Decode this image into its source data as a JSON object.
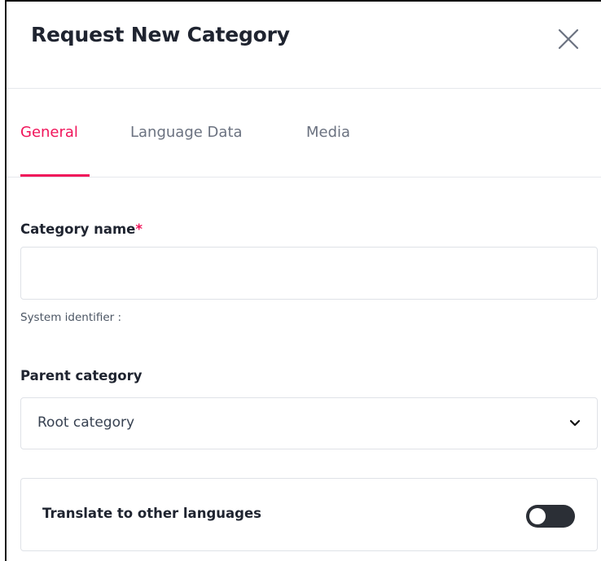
{
  "dialog": {
    "title": "Request New Category",
    "close_icon": "close-icon"
  },
  "tabs": [
    {
      "label": "General",
      "active": true
    },
    {
      "label": "Language Data",
      "active": false
    },
    {
      "label": "Media",
      "active": false
    }
  ],
  "form": {
    "category_name": {
      "label": "Category name",
      "required_marker": "*",
      "value": "",
      "placeholder": ""
    },
    "system_identifier": {
      "label": "System identifier :"
    },
    "parent_category": {
      "label": "Parent category",
      "selected_value": "Root category",
      "icon": "chevron-down-icon"
    },
    "translate": {
      "label": "Translate to other languages",
      "enabled": false
    }
  },
  "colors": {
    "accent": "#f0145a",
    "text": "#1f2430",
    "muted": "#6b7280",
    "border": "#dfe2e7",
    "toggle_off": "#2b2f36"
  }
}
